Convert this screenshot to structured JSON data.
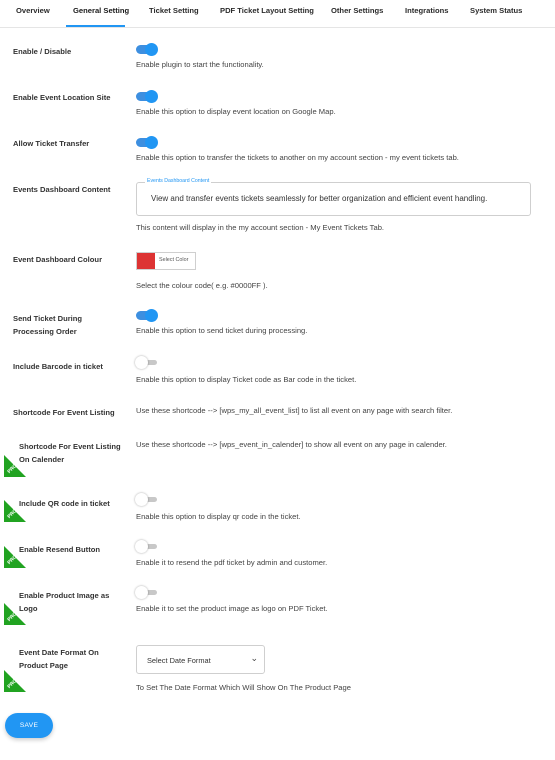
{
  "tabs": [
    {
      "label": "Overview"
    },
    {
      "label": "General Setting"
    },
    {
      "label": "Ticket Setting"
    },
    {
      "label": "PDF Ticket Layout Setting"
    },
    {
      "label": "Other Settings"
    },
    {
      "label": "Integrations"
    },
    {
      "label": "System Status"
    }
  ],
  "active_tab": "General Setting",
  "accent_color": "#2196f3",
  "pro_badge": "PRO",
  "settings": {
    "enable_disable": {
      "label": "Enable / Disable",
      "state": "on",
      "desc": "Enable plugin to start the functionality."
    },
    "event_location": {
      "label": "Enable Event Location Site",
      "state": "on",
      "desc": "Enable this option to display event location on Google Map."
    },
    "ticket_transfer": {
      "label": "Allow Ticket Transfer",
      "state": "on",
      "desc": "Enable this option to transfer the tickets to another on my account section - my event tickets tab."
    },
    "dashboard_content": {
      "label": "Events Dashboard Content",
      "legend": "Events Dashboard Content",
      "value": "View and transfer events tickets seamlessly for better organization and efficient event handling.",
      "desc": "This content will display in the my account section - My Event Tickets Tab."
    },
    "dashboard_colour": {
      "label": "Event Dashboard Colour",
      "color": "#dd3333",
      "picker_label": "Select Color",
      "desc": "Select the colour code( e.g. #0000FF )."
    },
    "send_ticket": {
      "label_line1": "Send Ticket During",
      "label_line2": "Processing Order",
      "state": "on",
      "desc": "Enable this option to send ticket during processing."
    },
    "barcode": {
      "label": "Include Barcode in ticket",
      "state": "off",
      "desc": "Enable this option to display Ticket code as Bar code in the ticket."
    },
    "shortcode_listing": {
      "label": "Shortcode For Event Listing",
      "desc": "Use these shortcode --> [wps_my_all_event_list] to list all event on any page with search filter."
    },
    "shortcode_calendar": {
      "label_line1": "Shortcode For Event Listing",
      "label_line2": "On Calender",
      "desc": "Use these shortcode --> [wps_event_in_calender] to show all event on any page in calender."
    },
    "qr_code": {
      "label": "Include QR code in ticket",
      "state": "off",
      "desc": "Enable this option to display qr code in the ticket."
    },
    "resend": {
      "label": "Enable Resend Button",
      "state": "off",
      "desc": "Enable it to resend the pdf ticket by admin and customer."
    },
    "product_image": {
      "label_line1": "Enable Product Image as",
      "label_line2": "Logo",
      "state": "off",
      "desc": "Enable it to set the product image as logo on PDF Ticket."
    },
    "date_format": {
      "label_line1": "Event Date Format On",
      "label_line2": "Product Page",
      "select_value": "Select Date Format",
      "desc": "To Set The Date Format Which Will Show On The Product Page"
    }
  },
  "save_label": "SAVE"
}
